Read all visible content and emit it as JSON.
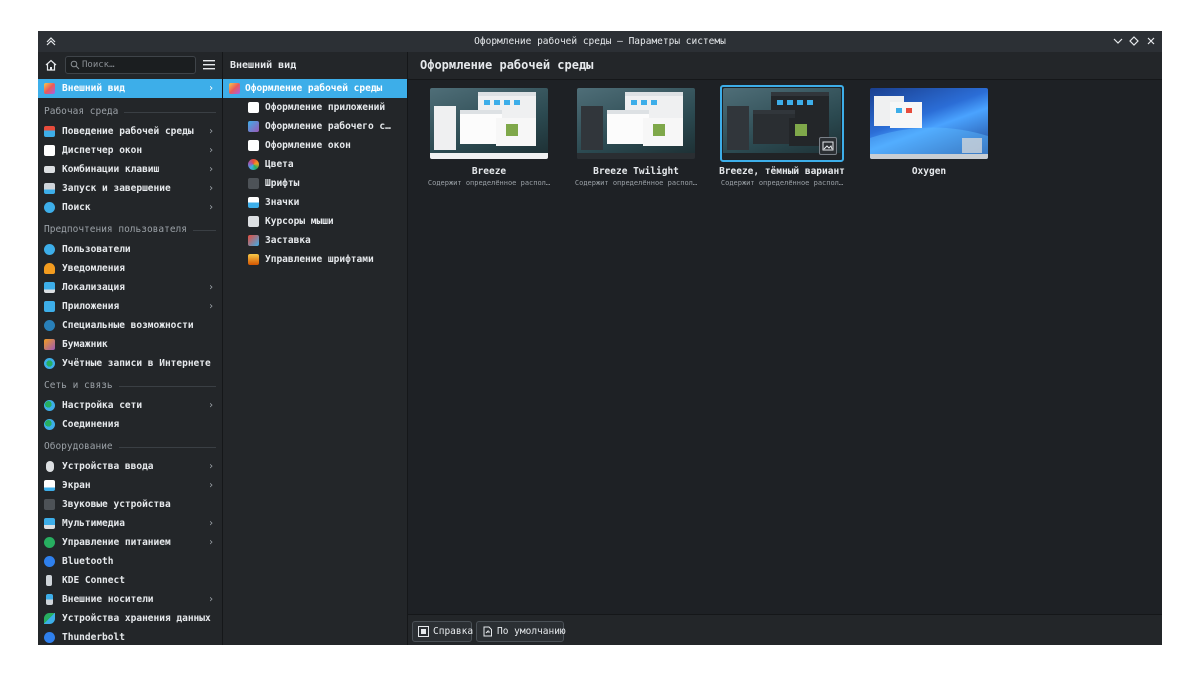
{
  "window": {
    "title": "Оформление рабочей среды — Параметры системы"
  },
  "sidebar": {
    "search_placeholder": "Поиск…",
    "selected": "Внешний вид",
    "categories": [
      "Рабочая среда",
      "Предпочтения пользователя",
      "Сеть и связь",
      "Оборудование"
    ],
    "items": [
      {
        "label": "Поведение рабочей среды",
        "icon": "desktop-behavior-icon",
        "chevron": true
      },
      {
        "label": "Диспетчер окон",
        "icon": "window-manager-icon",
        "chevron": true
      },
      {
        "label": "Комбинации клавиш",
        "icon": "keyboard-icon",
        "chevron": true
      },
      {
        "label": "Запуск и завершение",
        "icon": "startup-icon",
        "chevron": true
      },
      {
        "label": "Поиск",
        "icon": "search-globe-icon",
        "chevron": true
      },
      {
        "label": "Пользователи",
        "icon": "users-icon",
        "chevron": false
      },
      {
        "label": "Уведомления",
        "icon": "bell-icon",
        "chevron": false
      },
      {
        "label": "Локализация",
        "icon": "localization-icon",
        "chevron": true
      },
      {
        "label": "Приложения",
        "icon": "apps-icon",
        "chevron": true
      },
      {
        "label": "Специальные возможности",
        "icon": "accessibility-icon",
        "chevron": false
      },
      {
        "label": "Бумажник",
        "icon": "wallet-icon",
        "chevron": false
      },
      {
        "label": "Учётные записи в Интернете",
        "icon": "online-accounts-icon",
        "chevron": false
      },
      {
        "label": "Настройка сети",
        "icon": "network-icon",
        "chevron": true
      },
      {
        "label": "Соединения",
        "icon": "connections-icon",
        "chevron": false
      },
      {
        "label": "Устройства ввода",
        "icon": "mouse-icon",
        "chevron": true
      },
      {
        "label": "Экран",
        "icon": "display-icon",
        "chevron": true
      },
      {
        "label": "Звуковые устройства",
        "icon": "speaker-icon",
        "chevron": false
      },
      {
        "label": "Мультимедиа",
        "icon": "multimedia-icon",
        "chevron": true
      },
      {
        "label": "Управление питанием",
        "icon": "power-icon",
        "chevron": true
      },
      {
        "label": "Bluetooth",
        "icon": "bluetooth-icon",
        "chevron": false
      },
      {
        "label": "KDE Connect",
        "icon": "phone-icon",
        "chevron": false
      },
      {
        "label": "Внешние носители",
        "icon": "usb-icon",
        "chevron": true
      },
      {
        "label": "Устройства хранения данных",
        "icon": "storage-icon",
        "chevron": false
      },
      {
        "label": "Thunderbolt",
        "icon": "thunderbolt-icon",
        "chevron": false
      }
    ]
  },
  "subpanel": {
    "title": "Внешний вид",
    "items": [
      {
        "label": "Оформление рабочей среды",
        "icon": "global-theme-icon"
      },
      {
        "label": "Оформление приложений",
        "icon": "app-style-icon"
      },
      {
        "label": "Оформление рабочего с…",
        "icon": "plasma-style-icon"
      },
      {
        "label": "Оформление окон",
        "icon": "window-decoration-icon"
      },
      {
        "label": "Цвета",
        "icon": "colors-icon"
      },
      {
        "label": "Шрифты",
        "icon": "fonts-icon"
      },
      {
        "label": "Значки",
        "icon": "icons-icon"
      },
      {
        "label": "Курсоры мыши",
        "icon": "cursor-icon"
      },
      {
        "label": "Заставка",
        "icon": "splash-icon"
      },
      {
        "label": "Управление шрифтами",
        "icon": "font-manager-icon"
      }
    ]
  },
  "main": {
    "title": "Оформление рабочей среды",
    "themes": [
      {
        "name": "Breeze",
        "desc": "Содержит определённое распол…",
        "style": "light"
      },
      {
        "name": "Breeze Twilight",
        "desc": "Содержит определённое распол…",
        "style": "twilight"
      },
      {
        "name": "Breeze, тёмный вариант",
        "desc": "Содержит определённое распол…",
        "style": "dark",
        "selected": true
      },
      {
        "name": "Oxygen",
        "desc": "",
        "style": "oxygen"
      }
    ]
  },
  "footer": {
    "help_label": "Справка",
    "defaults_label": "По умолчанию"
  },
  "colors": {
    "accent": "#3daee9",
    "window_bg": "#1e2125",
    "panel_bg": "#232629"
  }
}
